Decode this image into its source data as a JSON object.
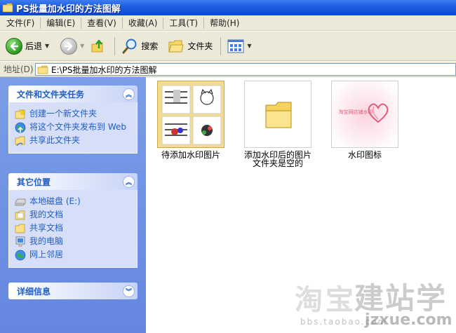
{
  "window": {
    "title": "PS批量加水印的方法图解"
  },
  "menu": {
    "items": [
      "文件(F)",
      "编辑(E)",
      "查看(V)",
      "收藏(A)",
      "工具(T)",
      "帮助(H)"
    ]
  },
  "toolbar": {
    "back_label": "后退",
    "search_label": "搜索",
    "folders_label": "文件夹"
  },
  "address": {
    "label": "地址(D)",
    "path": "E:\\PS批量加水印的方法图解"
  },
  "tasks_panel": {
    "title": "文件和文件夹任务",
    "items": [
      {
        "label": "创建一个新文件夹",
        "icon": "new-folder-icon"
      },
      {
        "label": "将这个文件夹发布到 Web",
        "icon": "publish-web-icon"
      },
      {
        "label": "共享此文件夹",
        "icon": "share-folder-icon"
      }
    ]
  },
  "places_panel": {
    "title": "其它位置",
    "items": [
      {
        "label": "本地磁盘 (E:)",
        "icon": "drive-icon"
      },
      {
        "label": "我的文档",
        "icon": "documents-icon"
      },
      {
        "label": "共享文档",
        "icon": "shared-docs-icon"
      },
      {
        "label": "我的电脑",
        "icon": "computer-icon"
      },
      {
        "label": "网上邻居",
        "icon": "network-icon"
      }
    ]
  },
  "details_panel": {
    "title": "详细信息"
  },
  "files": [
    {
      "name": "待添加水印图片",
      "type": "folder-with-thumbnails"
    },
    {
      "name": "添加水印后的图片\n文件夹是空的",
      "type": "empty-folder"
    },
    {
      "name": "水印图标",
      "type": "image"
    }
  ],
  "thumbnail_text": {
    "watermark_sample": "淘宝网店铺水印"
  },
  "watermark": {
    "line1": "淘宝",
    "line2": "建站学",
    "line3": "bbs.taobao.com",
    "line4": "jzxue.com"
  },
  "colors": {
    "titlebar": "#0a4ad0",
    "pane_blue": "#6486e0",
    "link_blue": "#215dc6"
  }
}
